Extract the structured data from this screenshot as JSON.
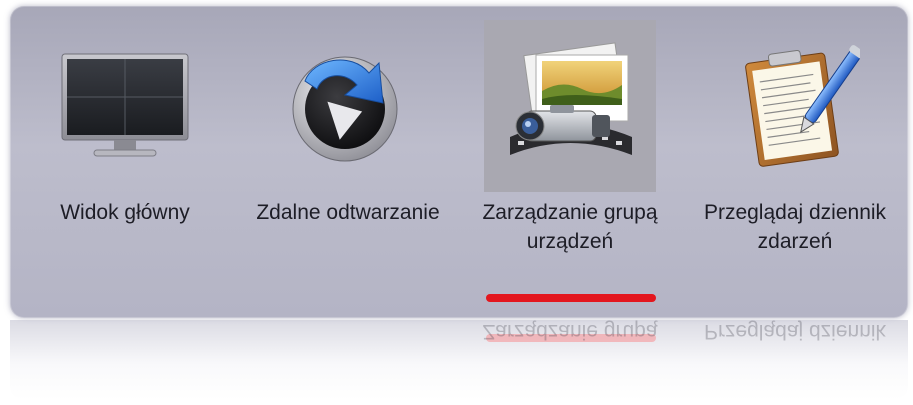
{
  "menu": {
    "items": [
      {
        "id": "main-view",
        "label": "Widok główny",
        "icon": "monitor-icon",
        "selected": false
      },
      {
        "id": "remote-playback",
        "label": "Zdalne odtwarzanie",
        "icon": "playback-arrow-icon",
        "selected": false
      },
      {
        "id": "device-group",
        "label": "Zarządzanie grupą urządzeń",
        "icon": "camera-photo-icon",
        "selected": true
      },
      {
        "id": "event-log",
        "label": "Przeglądaj dziennik zdarzeń",
        "icon": "clipboard-pen-icon",
        "selected": false
      }
    ]
  },
  "colors": {
    "panel_bg": "#b4b4c5",
    "selected_tile_bg": "#a9a8b1",
    "active_underline": "#e3161e",
    "label_text": "#1d1d26"
  }
}
